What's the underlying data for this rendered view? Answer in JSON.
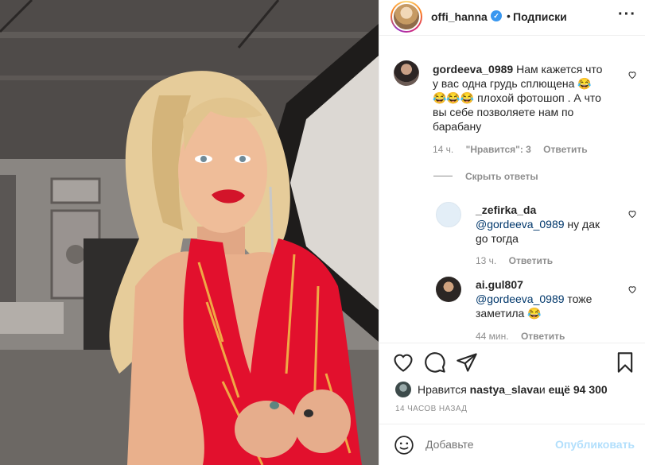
{
  "post": {
    "header": {
      "username": "offi_hanna",
      "follow_label": "Подписки",
      "dot": "•"
    },
    "comments": [
      {
        "username": "gordeeva_0989",
        "text_line1": "Нам кажется что",
        "text_line2": "у вас одна грудь сплющена 😂",
        "text_line3": "😂😂😂 плохой фотошоп . А что",
        "text_line4": "вы себе позволяете нам по",
        "text_line5": "барабану",
        "time": "14 ч.",
        "likes": "\"Нравится\": 3",
        "reply": "Ответить"
      }
    ],
    "hide_replies": "Скрыть ответы",
    "replies": [
      {
        "username": "_zefirka_da",
        "mention": "@gordeeva_0989",
        "text_a": " ну дак",
        "text_b": "go тогда",
        "time": "13 ч.",
        "reply": "Ответить"
      },
      {
        "username": "ai.gul807",
        "mention": "@gordeeva_0989",
        "text_a": " тоже",
        "text_b": "заметила 😂",
        "time": "44 мин.",
        "reply": "Ответить"
      }
    ],
    "likes_line": {
      "prefix": "Нравится ",
      "user": "nastya_slava",
      "middle": " и ",
      "count": "ещё 94 300"
    },
    "timestamp": "14 ЧАСОВ НАЗАД",
    "add_comment": {
      "placeholder": "Добавьте",
      "publish_label": "Опубликовать"
    }
  },
  "colors": {
    "accent": "#3897f0",
    "publish_disabled": "#b2dffc",
    "meta": "#8e8e8e"
  }
}
